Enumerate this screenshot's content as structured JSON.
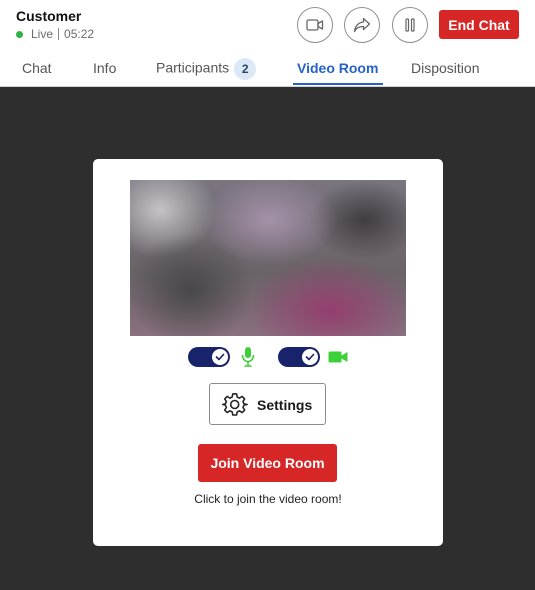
{
  "header": {
    "customer_name": "Customer",
    "status_label": "Live",
    "timer": "05:22",
    "end_chat_label": "End Chat",
    "icons": [
      "video-camera-icon",
      "share-forward-icon",
      "pause-icon"
    ]
  },
  "tabs": [
    {
      "label": "Chat",
      "active": false
    },
    {
      "label": "Info",
      "active": false
    },
    {
      "label": "Participants",
      "badge": "2",
      "active": false
    },
    {
      "label": "Video Room",
      "active": true
    },
    {
      "label": "Disposition",
      "active": false
    }
  ],
  "video_room": {
    "microphone_toggle_on": true,
    "camera_toggle_on": true,
    "settings_label": "Settings",
    "join_label": "Join Video Room",
    "hint": "Click to join the video room!"
  },
  "colors": {
    "accent_blue": "#2563c9",
    "danger_red": "#d62626",
    "live_green": "#2fb344",
    "toggle_navy": "#18236b",
    "device_green": "#3cd13a",
    "background": "#2e2e2e"
  }
}
